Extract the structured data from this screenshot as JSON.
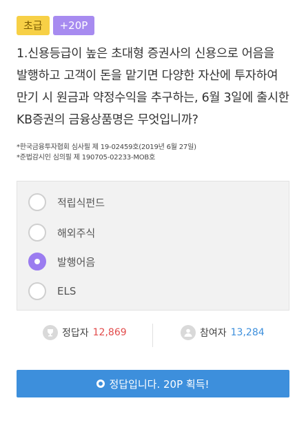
{
  "badges": {
    "level": "초급",
    "point": "+20P"
  },
  "question": {
    "text": "1.신용등급이 높은 초대형 증권사의 신용으로 어음을 발행하고 고객이 돈을 맡기면 다양한 자산에 투자하여 만기 시 원금과 약정수익을 추구하는, 6월 3일에 출시한 KB증권의 금융상품명은 무엇입니까?"
  },
  "notes": [
    "*한국금융투자협회 심사필 제 19-02459호(2019년 6월 27일)",
    "*준법감시인 심의필 제 190705-02233-MOB호"
  ],
  "options": [
    {
      "label": "적립식펀드",
      "selected": false
    },
    {
      "label": "해외주식",
      "selected": false
    },
    {
      "label": "발행어음",
      "selected": true
    },
    {
      "label": "ELS",
      "selected": false
    }
  ],
  "stats": {
    "correct_label": "정답자",
    "correct_count": "12,869",
    "participants_label": "참여자",
    "participants_count": "13,284"
  },
  "result": {
    "text": "정답입니다. 20P 획득!"
  },
  "colors": {
    "level_badge": "#f7d046",
    "point_badge": "#a78bf0",
    "selected_radio": "#9b7cf0",
    "result_bar": "#3d8fdc",
    "correct_count": "#e24b4b",
    "participants_count": "#3d8fdc"
  },
  "icons": {
    "correct": "trophy-icon",
    "participants": "person-icon",
    "result": "circle-icon"
  }
}
